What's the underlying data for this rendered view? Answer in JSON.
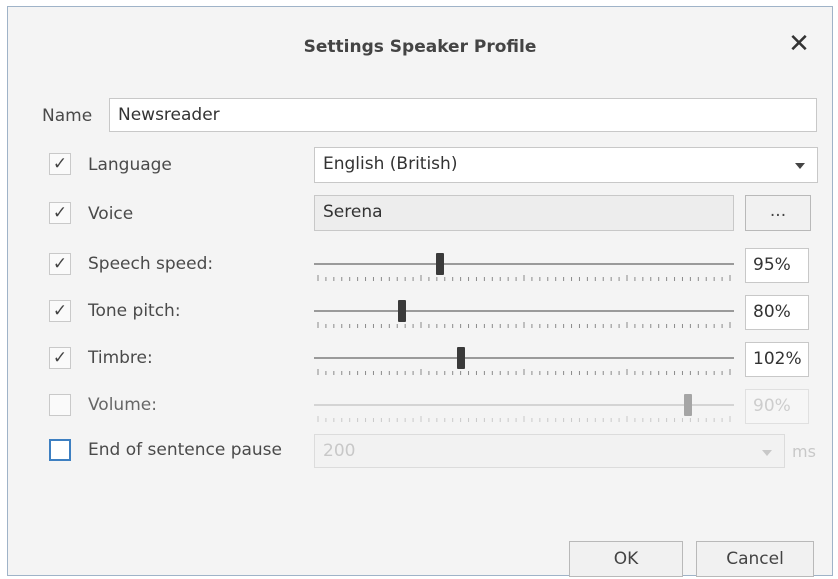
{
  "dialog": {
    "title": "Settings Speaker Profile",
    "close_glyph": "✕"
  },
  "name": {
    "label": "Name",
    "value": "Newsreader"
  },
  "language": {
    "label": "Language",
    "checked": true,
    "value": "English (British)"
  },
  "voice": {
    "label": "Voice",
    "checked": true,
    "value": "Serena",
    "browse_label": "..."
  },
  "sliders": [
    {
      "key": "speed",
      "label": "Speech speed:",
      "checked": true,
      "value_text": "95%",
      "level": 0.3,
      "enabled": true
    },
    {
      "key": "pitch",
      "label": "Tone pitch:",
      "checked": true,
      "value_text": "80%",
      "level": 0.21,
      "enabled": true
    },
    {
      "key": "timbre",
      "label": "Timbre:",
      "checked": true,
      "value_text": "102%",
      "level": 0.35,
      "enabled": true
    },
    {
      "key": "volume",
      "label": "Volume:",
      "checked": false,
      "value_text": "90%",
      "level": 0.89,
      "enabled": false
    }
  ],
  "pause": {
    "label": "End of sentence pause",
    "checked": false,
    "value": "200",
    "unit": "ms"
  },
  "buttons": {
    "ok": "OK",
    "cancel": "Cancel"
  },
  "check_glyph": "✓",
  "colors": {
    "focus_border": "#3d7fc1",
    "thumb": "#3a3a3a",
    "thumb_disabled": "#a5a5a5"
  }
}
